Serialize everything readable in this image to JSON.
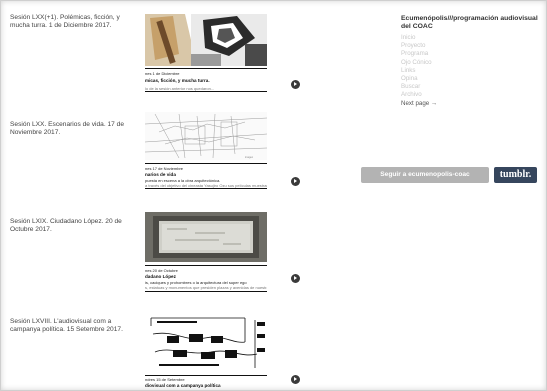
{
  "posts": [
    {
      "caption": "Sesión LXX(+1). Polémicas, ficción, y mucha turra. 1 de Diciembre 2017.",
      "thumb_date": "nes 1 de Diciembre",
      "thumb_title": "micas, ficción, y mucha turra.",
      "thumb_sub": "lo de la sesión anterior nos quedaron..."
    },
    {
      "caption": "Sesión LXX. Escenarios de vida. 17 de Noviembre 2017.",
      "thumb_date": "nes 17 de Noviembre",
      "thumb_title": "narios de vida",
      "thumb_sub": "puesta en escena a la obra arquitectónica.",
      "thumb_sub2": "a través del objetivo del cineasta Yasujiro Ozu sus películas muestran..."
    },
    {
      "caption": "Sesión LXIX. Ciudadano López. 20 de Octubre 2017.",
      "thumb_date": "nes 20 de Octubre",
      "thumb_title": "dadano López",
      "thumb_sub": "is, caciques y prohombres o la arquitectura del super ego",
      "thumb_sub2": "s, estatuas y monumentos que presiden plazas y avenidas de nuestras ciudades..."
    },
    {
      "caption": "Sesión LXVIII. L'audiovisual com a campanya política. 15 Setembre 2017.",
      "thumb_date": "ndres 15 de Setembre",
      "thumb_title": "diovisual com a campanya política"
    }
  ],
  "sidebar": {
    "blog_title": "Ecumenópolis///programación audiovisual del COAC",
    "links": [
      "Inicio",
      "Proyecto",
      "Programa",
      "Ojo Cónico",
      "Links",
      "Opina",
      "Buscar",
      "Archivo"
    ],
    "next_page": "Next page →"
  },
  "buttons": {
    "follow": "Seguir a ecumenopolis-coac",
    "tumblr": "tumblr."
  },
  "colors": {
    "tumblr_blue": "#36465d",
    "follow_gray": "#b3b3b3",
    "link_gray": "#c8c8c8"
  }
}
